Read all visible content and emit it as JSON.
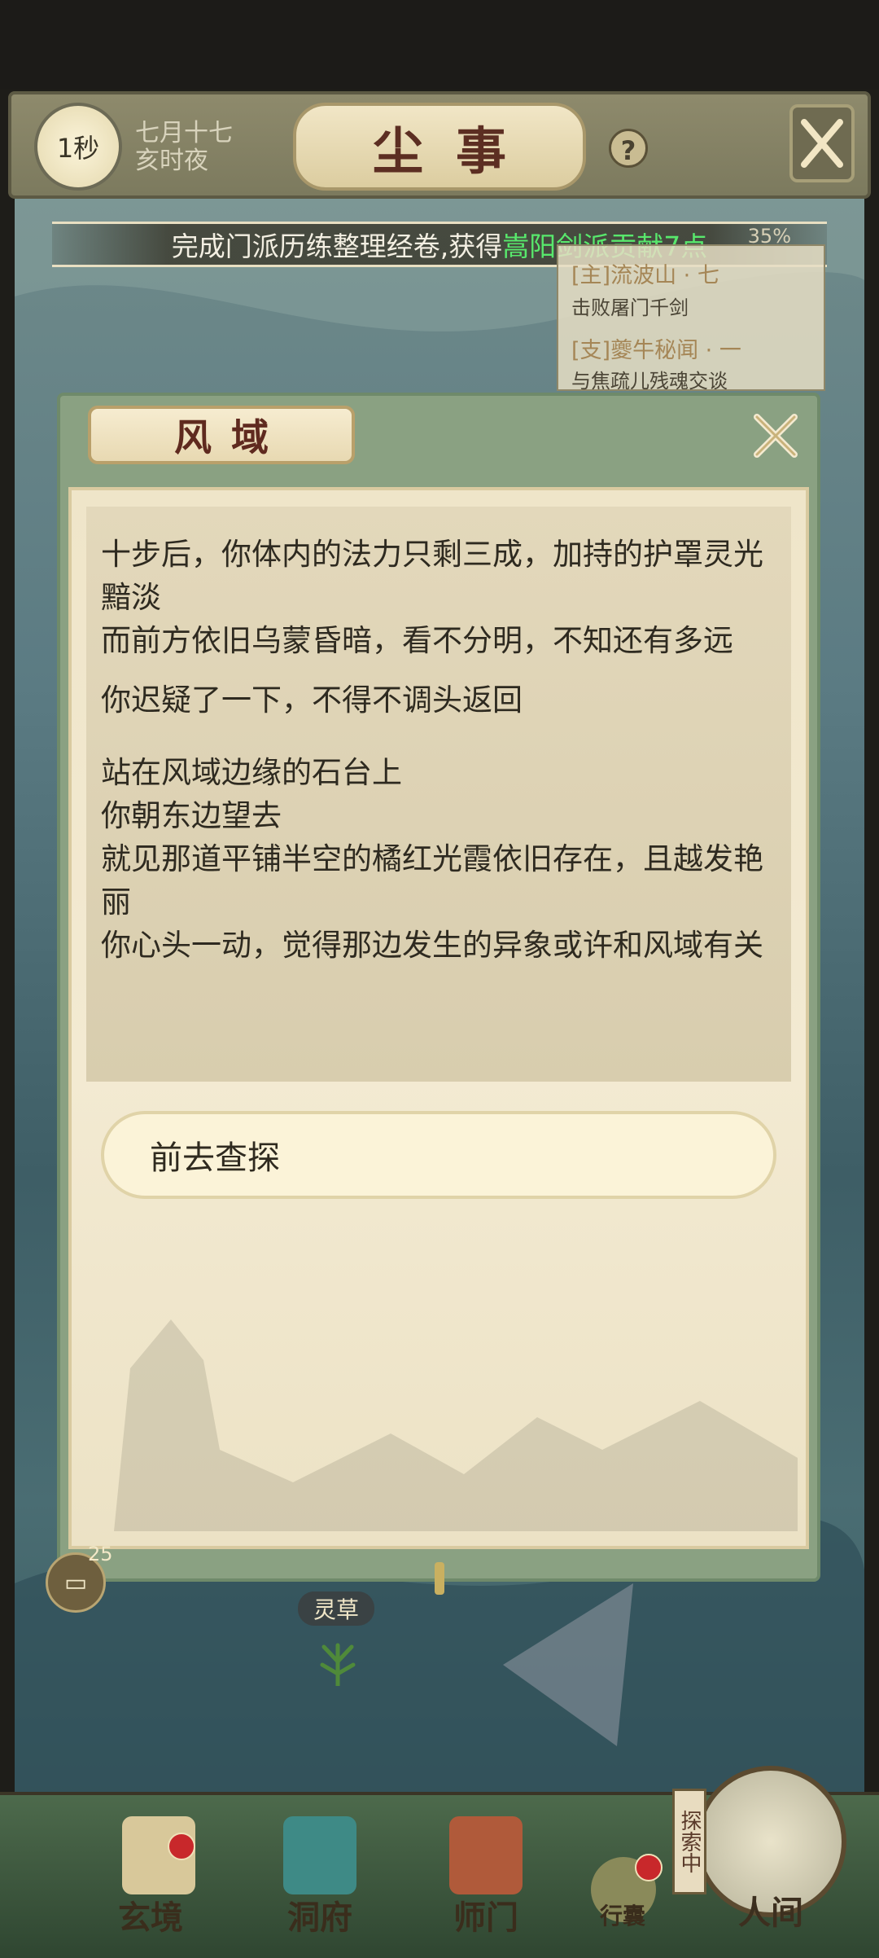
{
  "header": {
    "timer": "1秒",
    "date_line1": "七月十七",
    "date_line2": "亥时夜",
    "title": "尘事",
    "help": "?"
  },
  "notice": {
    "prefix": "完成门派历练整理经卷,获得",
    "highlight": "嵩阳剑派贡献7点",
    "highlight_color": "#58e86c"
  },
  "quests": [
    {
      "title": "[主]流波山 · 七",
      "subtitle": "击败屠门千剑"
    },
    {
      "title": "[支]夔牛秘闻 · 一",
      "subtitle": "与焦疏儿残魂交谈"
    }
  ],
  "quest_progress": "35%",
  "modal": {
    "title": "风域",
    "paragraphs": [
      "十步后，你体内的法力只剩三成，加持的护罩灵光黯淡",
      "而前方依旧乌蒙昏暗，看不分明，不知还有多远",
      "你迟疑了一下，不得不调头返回",
      "站在风域边缘的石台上",
      "你朝东边望去",
      "就见那道平铺半空的橘红光霞依旧存在，且越发艳丽",
      "你心头一动，觉得那边发生的异象或许和风域有关"
    ],
    "choice": "前去查探"
  },
  "map": {
    "herb_label": "灵草",
    "chat_count": "25"
  },
  "nav": {
    "tabs": [
      "玄境",
      "洞府",
      "师门",
      "行囊",
      "人间"
    ],
    "explore_tag": "探索中"
  },
  "colors": {
    "accent_green": "#58e86c",
    "title_red": "#5c2e22",
    "badge_red": "#c8282b"
  }
}
